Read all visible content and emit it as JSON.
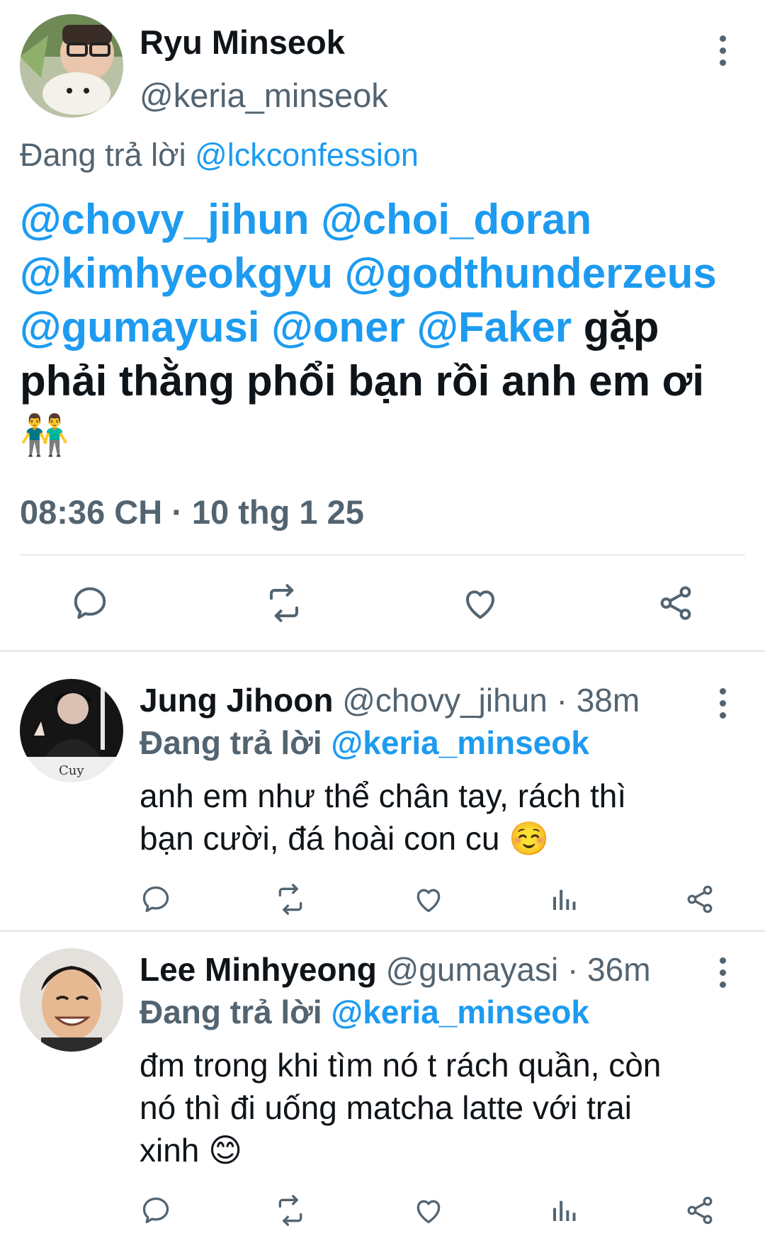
{
  "main_tweet": {
    "display_name": "Ryu Minseok",
    "handle": "@keria_minseok",
    "reply_prefix": "Đang trả lời",
    "reply_to": "@lckconfession",
    "mentions": [
      "@chovy_jihun",
      "@choi_doran",
      "@kimhyeokgyu",
      "@godthunderzeus",
      "@gumayusi",
      "@oner",
      "@Faker"
    ],
    "text_inline": "gặp",
    "text_rest": "phải thằng phổi bạn rồi anh em ơi",
    "emoji": "👬",
    "timestamp": "08:36 CH · 10 thg 1 25"
  },
  "replies": [
    {
      "display_name": "Jung Jihoon",
      "handle": "@chovy_jihun · 38m",
      "reply_prefix": "Đang trả lời",
      "reply_to": "@keria_minseok",
      "text_line1": "anh em như thể chân tay, rách thì",
      "text_line2": "bạn cười, đá hoài con cu",
      "emoji": "☺️"
    },
    {
      "display_name": "Lee Minhyeong",
      "handle": "@gumayasi · 36m",
      "reply_prefix": "Đang trả lời",
      "reply_to": "@keria_minseok",
      "text_line1": "đm trong khi tìm nó t rách quần, còn",
      "text_line2": "nó thì đi uống matcha latte với trai",
      "text_line3": "xinh",
      "emoji": "😊"
    }
  ],
  "colors": {
    "accent": "#1d9bf0",
    "text": "#0f1419",
    "muted": "#536471",
    "divider": "#e7e9ea"
  },
  "icons": [
    "more-icon",
    "reply-icon",
    "retweet-icon",
    "like-icon",
    "share-icon",
    "views-icon"
  ]
}
